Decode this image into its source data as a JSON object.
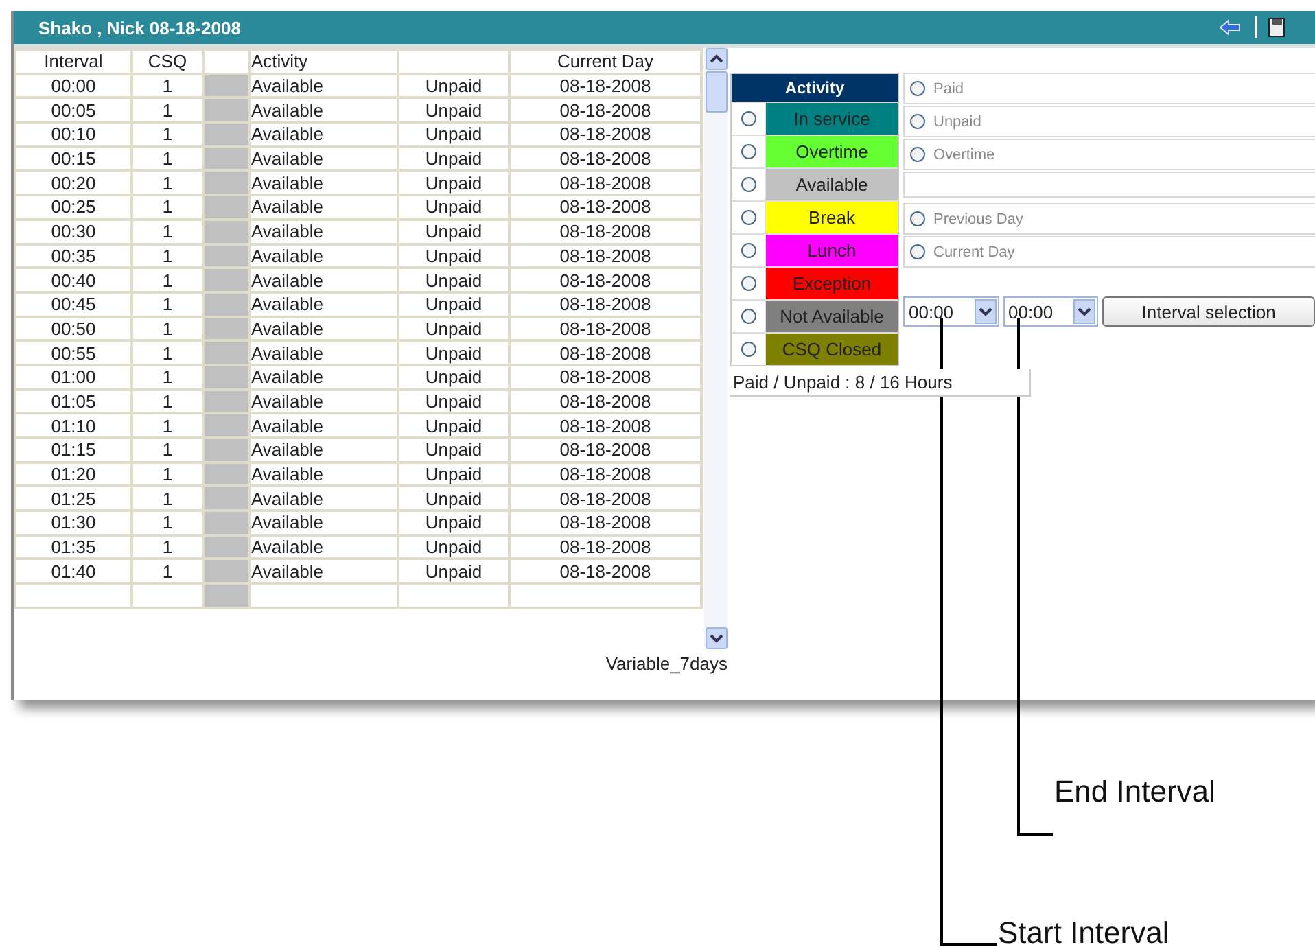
{
  "window": {
    "title": "Shako , Nick 08-18-2008"
  },
  "table": {
    "columns": [
      {
        "label": "Interval"
      },
      {
        "label": "CSQ"
      },
      {},
      {
        "label": "Activity"
      },
      {},
      {
        "label": "Current Day"
      }
    ],
    "rows": [
      {
        "interval": "00:00",
        "csq": "1",
        "color": "#c0c0c0",
        "activity": "Available",
        "pay": "Unpaid",
        "day": "08-18-2008"
      },
      {
        "interval": "00:05",
        "csq": "1",
        "color": "#c0c0c0",
        "activity": "Available",
        "pay": "Unpaid",
        "day": "08-18-2008"
      },
      {
        "interval": "00:10",
        "csq": "1",
        "color": "#c0c0c0",
        "activity": "Available",
        "pay": "Unpaid",
        "day": "08-18-2008"
      },
      {
        "interval": "00:15",
        "csq": "1",
        "color": "#c0c0c0",
        "activity": "Available",
        "pay": "Unpaid",
        "day": "08-18-2008"
      },
      {
        "interval": "00:20",
        "csq": "1",
        "color": "#c0c0c0",
        "activity": "Available",
        "pay": "Unpaid",
        "day": "08-18-2008"
      },
      {
        "interval": "00:25",
        "csq": "1",
        "color": "#c0c0c0",
        "activity": "Available",
        "pay": "Unpaid",
        "day": "08-18-2008"
      },
      {
        "interval": "00:30",
        "csq": "1",
        "color": "#c0c0c0",
        "activity": "Available",
        "pay": "Unpaid",
        "day": "08-18-2008"
      },
      {
        "interval": "00:35",
        "csq": "1",
        "color": "#c0c0c0",
        "activity": "Available",
        "pay": "Unpaid",
        "day": "08-18-2008"
      },
      {
        "interval": "00:40",
        "csq": "1",
        "color": "#c0c0c0",
        "activity": "Available",
        "pay": "Unpaid",
        "day": "08-18-2008"
      },
      {
        "interval": "00:45",
        "csq": "1",
        "color": "#c0c0c0",
        "activity": "Available",
        "pay": "Unpaid",
        "day": "08-18-2008"
      },
      {
        "interval": "00:50",
        "csq": "1",
        "color": "#c0c0c0",
        "activity": "Available",
        "pay": "Unpaid",
        "day": "08-18-2008"
      },
      {
        "interval": "00:55",
        "csq": "1",
        "color": "#c0c0c0",
        "activity": "Available",
        "pay": "Unpaid",
        "day": "08-18-2008"
      },
      {
        "interval": "01:00",
        "csq": "1",
        "color": "#c0c0c0",
        "activity": "Available",
        "pay": "Unpaid",
        "day": "08-18-2008"
      },
      {
        "interval": "01:05",
        "csq": "1",
        "color": "#c0c0c0",
        "activity": "Available",
        "pay": "Unpaid",
        "day": "08-18-2008"
      },
      {
        "interval": "01:10",
        "csq": "1",
        "color": "#c0c0c0",
        "activity": "Available",
        "pay": "Unpaid",
        "day": "08-18-2008"
      },
      {
        "interval": "01:15",
        "csq": "1",
        "color": "#c0c0c0",
        "activity": "Available",
        "pay": "Unpaid",
        "day": "08-18-2008"
      },
      {
        "interval": "01:20",
        "csq": "1",
        "color": "#c0c0c0",
        "activity": "Available",
        "pay": "Unpaid",
        "day": "08-18-2008"
      },
      {
        "interval": "01:25",
        "csq": "1",
        "color": "#c0c0c0",
        "activity": "Available",
        "pay": "Unpaid",
        "day": "08-18-2008"
      },
      {
        "interval": "01:30",
        "csq": "1",
        "color": "#c0c0c0",
        "activity": "Available",
        "pay": "Unpaid",
        "day": "08-18-2008"
      },
      {
        "interval": "01:35",
        "csq": "1",
        "color": "#c0c0c0",
        "activity": "Available",
        "pay": "Unpaid",
        "day": "08-18-2008"
      },
      {
        "interval": "01:40",
        "csq": "1",
        "color": "#c0c0c0",
        "activity": "Available",
        "pay": "Unpaid",
        "day": "08-18-2008"
      }
    ]
  },
  "schedule_name": "Variable_7days",
  "legend": {
    "title": "Activity",
    "items": [
      {
        "label": "In service",
        "color": "#008080",
        "selected": false
      },
      {
        "label": "Overtime",
        "color": "#66ff33",
        "selected": false
      },
      {
        "label": "Available",
        "color": "#c0c0c0",
        "selected": false
      },
      {
        "label": "Break",
        "color": "#ffff00",
        "selected": false
      },
      {
        "label": "Lunch",
        "color": "#ff00ff",
        "selected": false
      },
      {
        "label": "Exception",
        "color": "#ff0000",
        "selected": false
      },
      {
        "label": "Not Available",
        "color": "#808080",
        "selected": false
      },
      {
        "label": "CSQ Closed",
        "color": "#808000",
        "selected": false
      }
    ]
  },
  "pay_options": [
    {
      "label": "Paid",
      "selected": false
    },
    {
      "label": "Unpaid",
      "selected": false
    },
    {
      "label": "Overtime",
      "selected": false
    }
  ],
  "day_options": [
    {
      "label": "Previous Day",
      "selected": false
    },
    {
      "label": "Current Day",
      "selected": false
    }
  ],
  "start_interval": {
    "value": "00:00"
  },
  "end_interval": {
    "value": "00:00"
  },
  "interval_button": "Interval selection",
  "summary": "Paid / Unpaid : 8 / 16 Hours",
  "annotations": [
    {
      "kind": "end",
      "label": "End Interval"
    },
    {
      "kind": "start",
      "label": "Start Interval"
    }
  ]
}
